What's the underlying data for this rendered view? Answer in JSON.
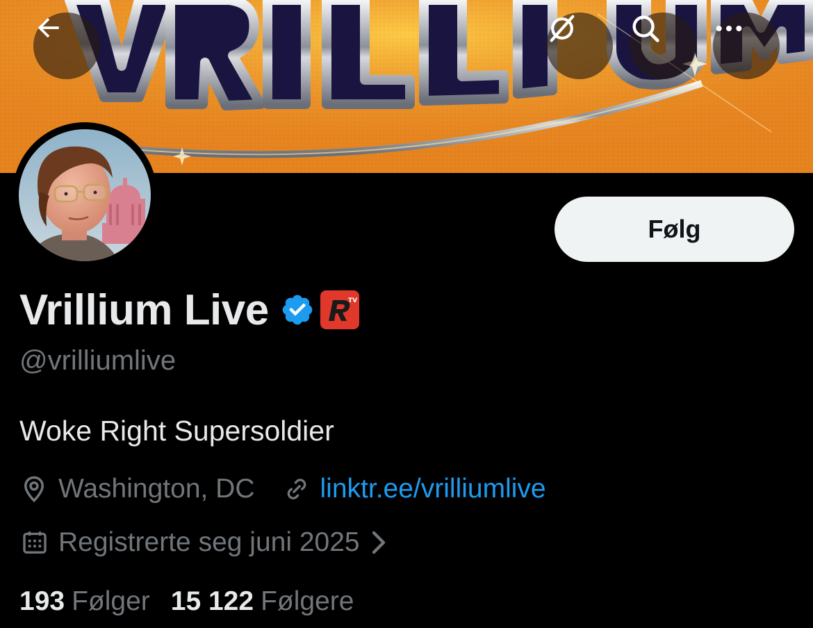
{
  "banner": {
    "text": "VRILLIUM",
    "colors": {
      "background": "#e88724",
      "letters_fill": "#1a1440",
      "letters_chrome": "#c9ccd3"
    }
  },
  "topbar": {
    "back_icon": "arrow-left-icon",
    "grok_icon": "grok-slash-icon",
    "search_icon": "search-icon",
    "more_icon": "ellipsis-icon"
  },
  "profile": {
    "display_name": "Vrillium Live",
    "handle": "@vrilliumlive",
    "bio": "Woke Right Supersoldier",
    "location": "Washington, DC",
    "website": "linktr.ee/vrilliumlive",
    "joined": "Registrerte seg juni 2025",
    "verified_color": "#1d9bf0",
    "affiliate_badge": {
      "letter": "R",
      "superscript": "TV",
      "color": "#e0392b"
    }
  },
  "actions": {
    "follow_label": "Følg"
  },
  "stats": {
    "following_count": "193",
    "following_label": "Følger",
    "followers_count": "15 122",
    "followers_label": "Følgere"
  },
  "colors": {
    "accent": "#1d9bf0",
    "text_primary": "#e7e9ea",
    "text_secondary": "#71767b",
    "background": "#000000"
  }
}
